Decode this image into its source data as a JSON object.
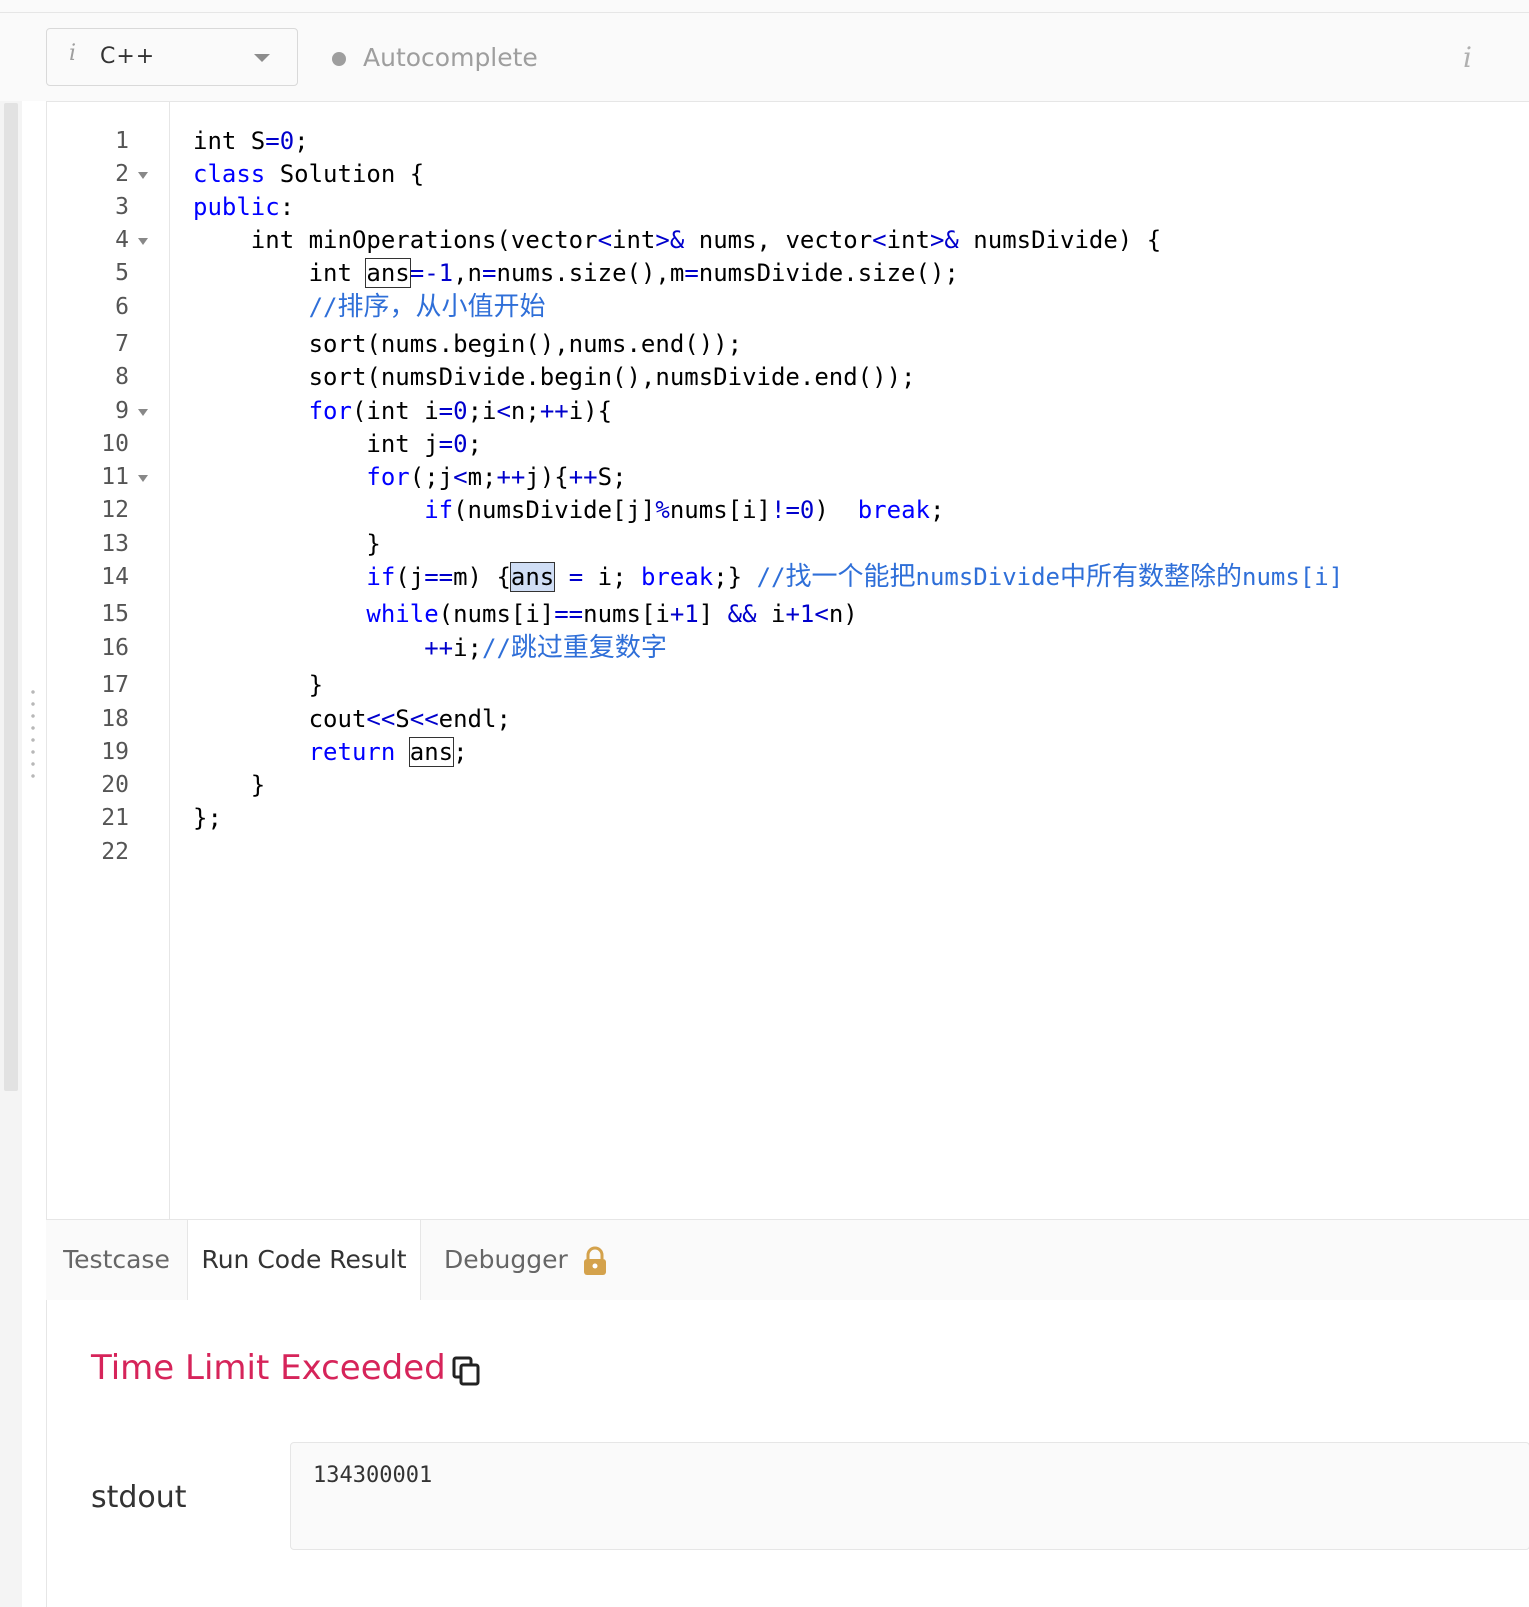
{
  "toolbar": {
    "language": "C++",
    "autocomplete_label": "Autocomplete",
    "info_glyph": "i"
  },
  "editor": {
    "line_numbers": [
      "1",
      "2",
      "3",
      "4",
      "5",
      "6",
      "7",
      "8",
      "9",
      "10",
      "11",
      "12",
      "13",
      "14",
      "15",
      "16",
      "17",
      "18",
      "19",
      "20",
      "21",
      "22"
    ],
    "foldable_lines": [
      2,
      4,
      9,
      11
    ],
    "code": [
      "int S=0;",
      "class Solution {",
      "public:",
      "    int minOperations(vector<int>& nums, vector<int>& numsDivide) {",
      "        int ans=-1,n=nums.size(),m=numsDivide.size();",
      "        //排序，从小值开始",
      "        sort(nums.begin(),nums.end());",
      "        sort(numsDivide.begin(),numsDivide.end());",
      "        for(int i=0;i<n;++i){",
      "            int j=0;",
      "            for(;j<m;++j){++S;",
      "                if(numsDivide[j]%nums[i]!=0)  break;",
      "            }",
      "            if(j==m) {ans = i; break;} //找一个能把numsDivide中所有数整除的nums[i]",
      "            while(nums[i]==nums[i+1] && i+1<n)",
      "                ++i;//跳过重复数字",
      "        }",
      "        cout<<S<<endl;",
      "        return ans;",
      "    }",
      "};",
      ""
    ]
  },
  "panel": {
    "tabs": [
      "Testcase",
      "Run Code Result",
      "Debugger"
    ],
    "active_tab": "Run Code Result",
    "status": "Time Limit Exceeded",
    "stdout_label": "stdout",
    "stdout_value": "134300001"
  },
  "colors": {
    "keyword": "#0000ff",
    "comment": "#2f6fd8",
    "status_error": "#d6245a",
    "lock": "#d4a24c"
  },
  "icons": {
    "language_info": "info-icon",
    "dropdown": "caret-down-icon",
    "autocomplete_indicator": "dot-icon",
    "settings_info": "info-icon",
    "debugger_lock": "lock-icon",
    "copy": "copy-icon"
  }
}
